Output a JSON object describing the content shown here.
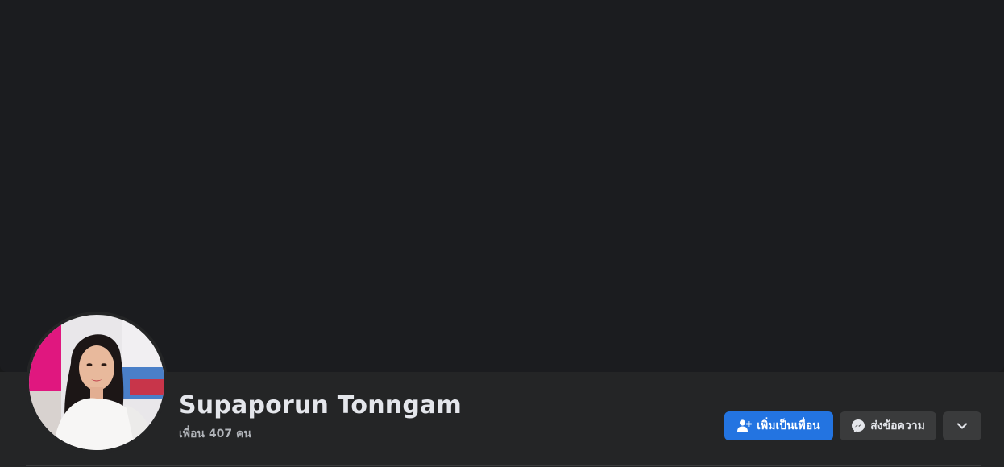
{
  "profile": {
    "name": "Supaporun Tonngam",
    "friends_label": "เพื่อน 407 คน"
  },
  "actions": {
    "add_friend_label": "เพิ่มเป็นเพื่อน",
    "add_friend_icon": "person-add-icon",
    "message_label": "ส่งข้อความ",
    "message_icon": "messenger-icon",
    "more_icon": "chevron-down-icon"
  },
  "colors": {
    "primary_button": "#2374e1",
    "secondary_button": "#3a3b3c",
    "cover_background": "#1b1c1f",
    "band_background": "#242526"
  }
}
